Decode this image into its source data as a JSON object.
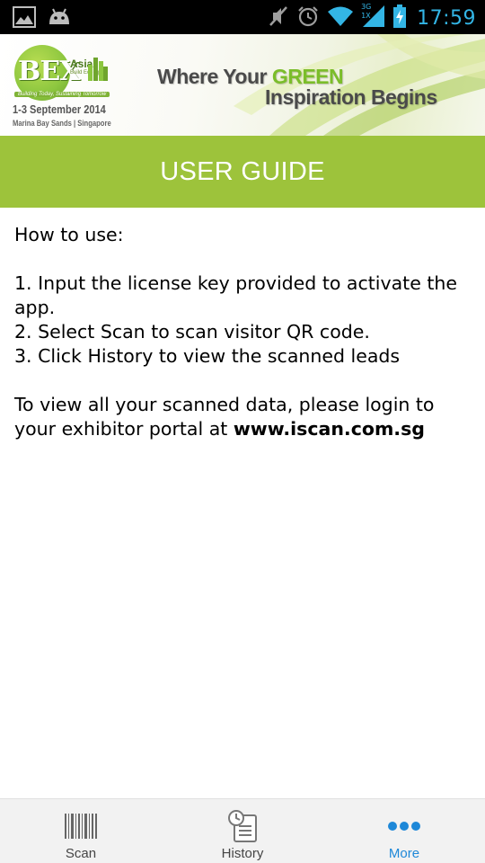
{
  "status_bar": {
    "time": "17:59",
    "network_label": "3G",
    "network_label_2": "1X",
    "icons": [
      "gallery-icon",
      "android-icon",
      "mute-icon",
      "alarm-icon",
      "wifi-icon",
      "signal-icon",
      "battery-charging-icon"
    ]
  },
  "banner": {
    "logo_text": "BEX",
    "logo_region": "Asia",
    "logo_sub": "Build Eco Xpo",
    "logo_tagline": "Building Today, Sustaining Tomorrow",
    "dates": "1-3 September 2014",
    "venue": "Marina Bay Sands | Singapore",
    "tagline_part1": "Where Your ",
    "tagline_green": "GREEN",
    "tagline_part2": "Inspiration Begins"
  },
  "title_bar": {
    "title": "USER GUIDE"
  },
  "content": {
    "heading": "How to use:",
    "steps": [
      "1. Input the license key provided to activate the app.",
      "2. Select Scan to scan visitor QR code.",
      "3. Click History to view the scanned leads"
    ],
    "portal_text": "To view all your scanned data, please login to your exhibitor portal at ",
    "portal_url": "www.iscan.com.sg"
  },
  "bottom_nav": {
    "items": [
      {
        "label": "Scan",
        "icon": "barcode-icon"
      },
      {
        "label": "History",
        "icon": "history-icon"
      },
      {
        "label": "More",
        "icon": "more-dots-icon"
      }
    ],
    "active_index": 2,
    "active_color": "#1e88d8"
  },
  "colors": {
    "title_bar": "#9dc33b",
    "status_time": "#33b5e5",
    "brand_green": "#7bbd2a"
  }
}
